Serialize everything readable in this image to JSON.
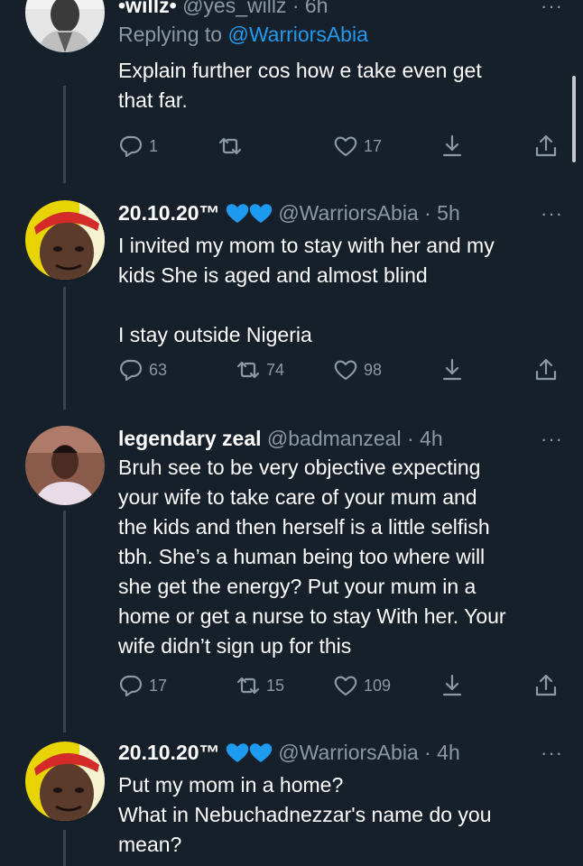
{
  "colors": {
    "background": "#15202b",
    "accent": "#1d9bf0",
    "muted": "#8b98a5",
    "thread_line": "#38444d"
  },
  "tweets": [
    {
      "name": "•willz•",
      "handle": "@yes_willz",
      "time": "· 6h",
      "replying_prefix": "Replying to",
      "replying_to": "@WarriorsAbia",
      "text_lines": [
        "Explain further cos how e take even get",
        "that far."
      ],
      "replies": "1",
      "retweets": "",
      "likes": "17",
      "avatar_icon": "person-photo-icon"
    },
    {
      "name": "20.10.20™",
      "handle": "@WarriorsAbia",
      "time": "· 5h",
      "badge_icons": [
        "blue-heart-icon",
        "blue-heart-icon"
      ],
      "text_lines": [
        "I invited my mom to stay with her and my",
        "kids She is aged and almost blind",
        "",
        "I stay outside Nigeria"
      ],
      "replies": "63",
      "retweets": "74",
      "likes": "98",
      "avatar_icon": "man-red-cap-icon"
    },
    {
      "name": "legendary zeal",
      "handle": "@badmanzeal",
      "time": "· 4h",
      "text_lines": [
        "Bruh see to be very objective expecting",
        "your wife to take care of your mum and",
        "the kids and then herself is a little selfish",
        "tbh. She’s a human being too where will",
        "she get the energy? Put your mum in a",
        "home or get a nurse to stay With her. Your",
        "wife didn’t sign up for this"
      ],
      "replies": "17",
      "retweets": "15",
      "likes": "109",
      "avatar_icon": "person-photo-icon"
    },
    {
      "name": "20.10.20™",
      "handle": "@WarriorsAbia",
      "time": "· 4h",
      "badge_icons": [
        "blue-heart-icon",
        "blue-heart-icon"
      ],
      "text_lines": [
        "Put my mom in a home?",
        "What in Nebuchadnezzar's name do you",
        "mean?"
      ],
      "avatar_icon": "man-red-cap-icon"
    }
  ],
  "more_label": "···"
}
